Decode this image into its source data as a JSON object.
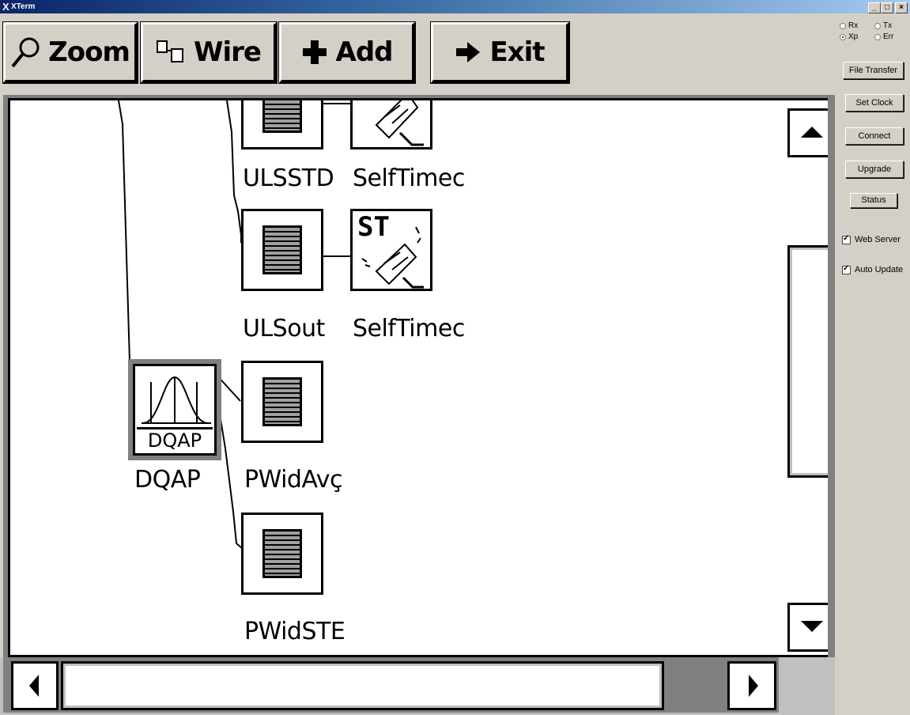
{
  "window": {
    "title": "XTerm",
    "icon": "x-logo-icon",
    "min": "_",
    "max": "□",
    "close": "×"
  },
  "toolbar": {
    "zoom_label": "Zoom",
    "wire_label": "Wire",
    "add_label": "Add",
    "exit_label": "Exit"
  },
  "side": {
    "radios": [
      {
        "label": "Rx",
        "selected": false
      },
      {
        "label": "Tx",
        "selected": false
      },
      {
        "label": "Xp",
        "selected": true
      },
      {
        "label": "Err",
        "selected": false
      }
    ],
    "file_transfer": "File Transfer",
    "set_clock": "Set Clock",
    "connect": "Connect",
    "upgrade": "Upgrade",
    "status": "Status",
    "web_server": {
      "label": "Web Server",
      "checked": true
    },
    "auto_update": {
      "label": "Auto Update",
      "checked": true
    }
  },
  "nodes": {
    "ulsstd": "ULSSTD",
    "selftimed_1": "SelfTimec",
    "ulsout": "ULSout",
    "selftimed_2": "SelfTimec",
    "dqap": "DQAP",
    "dqap_caption": "DQAP",
    "pwidavg": "PWidAvç",
    "pwidstd": "PWidSTE",
    "st_text": "ST"
  }
}
